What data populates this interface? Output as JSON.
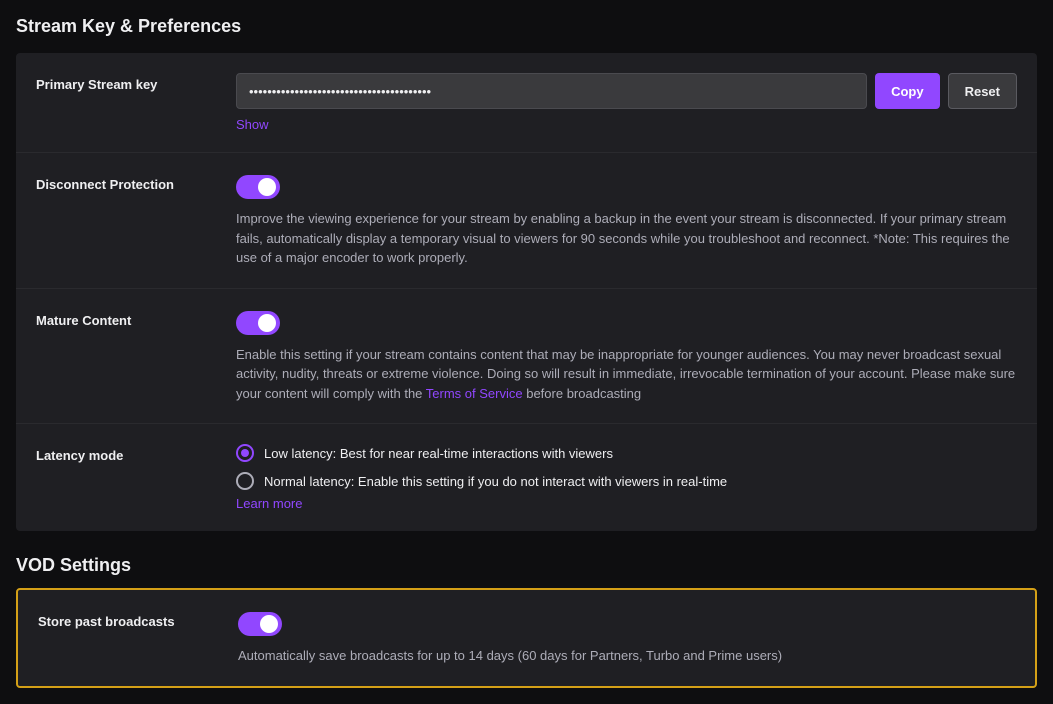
{
  "page": {
    "title": "Stream Key & Preferences"
  },
  "vod": {
    "title": "VOD Settings"
  },
  "stream_key": {
    "label": "Primary Stream key",
    "value": "••••••••••••••••••••••••••••••••••••••••",
    "copy_label": "Copy",
    "reset_label": "Reset",
    "show_label": "Show"
  },
  "disconnect_protection": {
    "label": "Disconnect Protection",
    "description": "Improve the viewing experience for your stream by enabling a backup in the event your stream is disconnected. If your primary stream fails, automatically display a temporary visual to viewers for 90 seconds while you troubleshoot and reconnect. *Note: This requires the use of a major encoder to work properly.",
    "enabled": true
  },
  "mature_content": {
    "label": "Mature Content",
    "description_before": "Enable this setting if your stream contains content that may be inappropriate for younger audiences. You may never broadcast sexual activity, nudity, threats or extreme violence. Doing so will result in immediate, irrevocable termination of your account. Please make sure your content will comply with the ",
    "tos_link_text": "Terms of Service",
    "description_after": " before broadcasting",
    "enabled": true
  },
  "latency_mode": {
    "label": "Latency mode",
    "options": [
      {
        "id": "low",
        "label": "Low latency: Best for near real-time interactions with viewers",
        "selected": true
      },
      {
        "id": "normal",
        "label": "Normal latency: Enable this setting if you do not interact with viewers in real-time",
        "selected": false
      }
    ],
    "learn_more": "Learn more"
  },
  "store_broadcasts": {
    "label": "Store past broadcasts",
    "description": "Automatically save broadcasts for up to 14 days (60 days for Partners, Turbo and Prime users)",
    "enabled": true
  }
}
